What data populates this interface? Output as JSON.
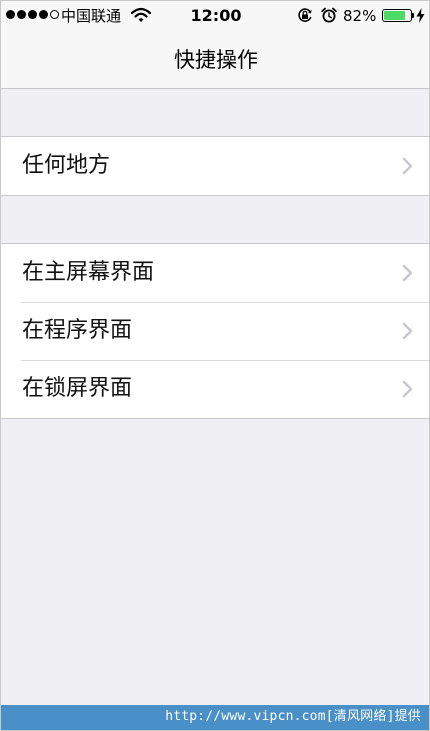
{
  "status_bar": {
    "signal_dots": [
      "full",
      "full",
      "full",
      "full",
      "empty"
    ],
    "carrier": "中国联通",
    "wifi_icon": "wifi-icon",
    "time": "12:00",
    "rotation_lock_icon": "rotation-lock-icon",
    "alarm_icon": "alarm-icon",
    "battery_percent": "82%",
    "battery_level": 0.82,
    "battery_color": "#4cd964",
    "charging_icon": "bolt-icon"
  },
  "nav": {
    "title": "快捷操作"
  },
  "groups": [
    {
      "items": [
        {
          "label": "任何地方",
          "icon": "chevron-right-icon"
        }
      ]
    },
    {
      "items": [
        {
          "label": "在主屏幕界面",
          "icon": "chevron-right-icon"
        },
        {
          "label": "在程序界面",
          "icon": "chevron-right-icon"
        },
        {
          "label": "在锁屏界面",
          "icon": "chevron-right-icon"
        }
      ]
    }
  ],
  "watermark": {
    "text": "http://www.vipcn.com[清风网络]提供",
    "color": "#4a90c8"
  },
  "colors": {
    "background": "#efeff4",
    "bar_background": "#f7f7f7",
    "separator": "#c8c7cc",
    "chevron": "#c7c7cc"
  }
}
